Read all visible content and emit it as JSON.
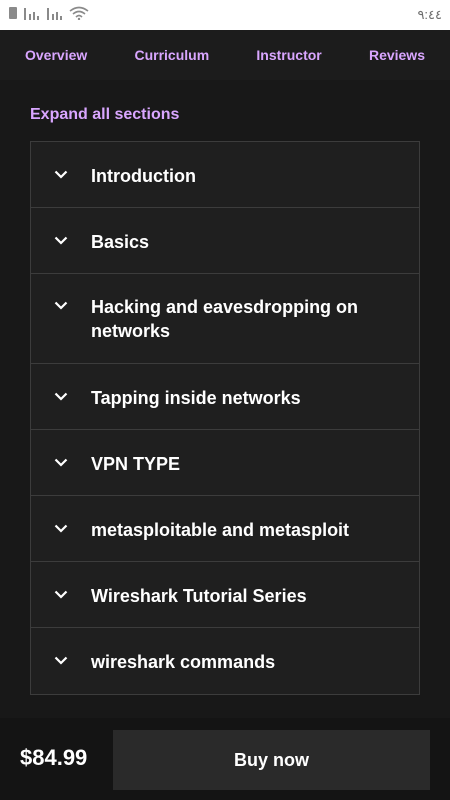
{
  "status_bar": {
    "time": "٩:٤٤",
    "icons": [
      "sim-icon",
      "signal-icon",
      "signal-icon",
      "wifi-icon"
    ]
  },
  "tabs": [
    {
      "label": "Overview"
    },
    {
      "label": "Curriculum"
    },
    {
      "label": "Instructor"
    },
    {
      "label": "Reviews"
    }
  ],
  "expand_all_label": "Expand all sections",
  "sections": [
    {
      "title": "Introduction"
    },
    {
      "title": "Basics"
    },
    {
      "title": "Hacking and eavesdropping on networks"
    },
    {
      "title": "Tapping inside networks"
    },
    {
      "title": "VPN TYPE"
    },
    {
      "title": "metasploitable and metasploit"
    },
    {
      "title": "Wireshark Tutorial Series"
    },
    {
      "title": "wireshark commands"
    }
  ],
  "footer": {
    "price": "$84.99",
    "buy_label": "Buy now"
  },
  "colors": {
    "accent": "#d9a6ff",
    "background": "#141414",
    "panel": "#1f1f1f",
    "border": "#3c3c3c"
  }
}
